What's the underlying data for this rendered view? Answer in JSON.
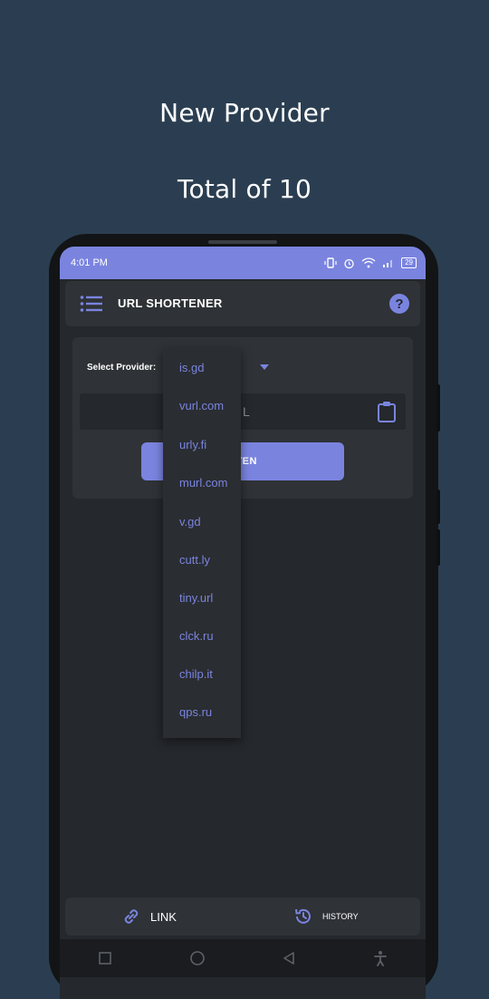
{
  "promo": {
    "headline": "New Provider",
    "subheadline": "Total of 10"
  },
  "status_bar": {
    "time": "4:01 PM",
    "battery": "29"
  },
  "appbar": {
    "title": "URL SHORTENER",
    "help_symbol": "?"
  },
  "form": {
    "select_label": "Select Provider:",
    "selected_provider": "is.gd",
    "url_placeholder_visible": "L",
    "shorten_label_visible": "RTEN"
  },
  "dropdown": {
    "options": [
      "is.gd",
      "vurl.com",
      "urly.fi",
      "murl.com",
      "v.gd",
      "cutt.ly",
      "tiny.url",
      "clck.ru",
      "chilp.it",
      "qps.ru"
    ]
  },
  "bottom_nav": {
    "link_label": "LINK",
    "history_label": "HISTORY"
  },
  "colors": {
    "accent": "#7a84df",
    "background": "#2b3e51",
    "screen": "#25282c",
    "surface": "#2f3236"
  },
  "icons": [
    "menu-icon",
    "help-icon",
    "clipboard-icon",
    "link-icon",
    "history-icon",
    "recents-icon",
    "home-icon",
    "back-icon",
    "accessibility-icon"
  ]
}
